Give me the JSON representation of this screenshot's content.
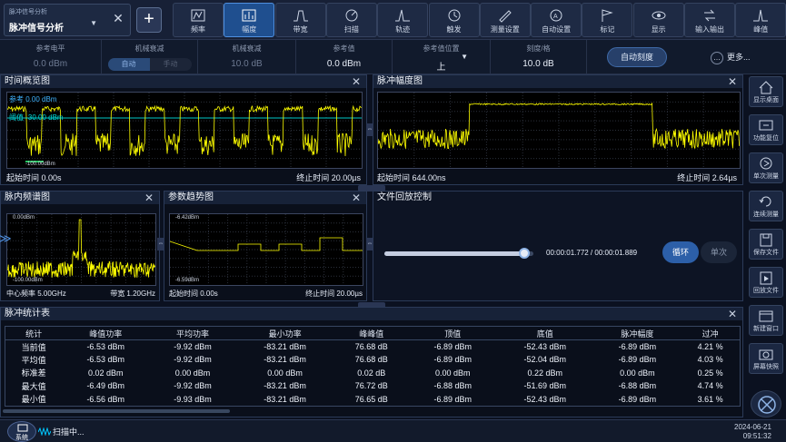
{
  "app": {
    "small_title": "脉冲信号分析",
    "title": "脉冲信号分析"
  },
  "toolbar": [
    {
      "key": "freq",
      "label": "频率",
      "icon": "frequency-icon"
    },
    {
      "key": "amp",
      "label": "幅度",
      "icon": "amplitude-icon",
      "selected": true
    },
    {
      "key": "bw",
      "label": "带宽",
      "icon": "bandwidth-icon"
    },
    {
      "key": "sweep",
      "label": "扫描",
      "icon": "sweep-icon"
    },
    {
      "key": "trace",
      "label": "轨迹",
      "icon": "trace-icon"
    },
    {
      "key": "trig",
      "label": "触发",
      "icon": "trigger-icon"
    },
    {
      "key": "meas",
      "label": "测量设置",
      "icon": "measure-settings-icon"
    },
    {
      "key": "auto",
      "label": "自动设置",
      "icon": "auto-settings-icon"
    },
    {
      "key": "marker",
      "label": "标记",
      "icon": "marker-icon"
    },
    {
      "key": "display",
      "label": "显示",
      "icon": "display-icon"
    },
    {
      "key": "io",
      "label": "输入输出",
      "icon": "input-output-icon"
    },
    {
      "key": "peak",
      "label": "峰值",
      "icon": "peak-icon"
    }
  ],
  "params": {
    "ref_level_label": "参考电平",
    "ref_level_value": "0.0 dBm",
    "mech_atten_label": "机械衰减",
    "mech_auto": "自动",
    "mech_manual": "手动",
    "mech_atten2_label": "机械衰减",
    "mech_atten2_value": "10.0 dB",
    "ref_value_label": "参考值",
    "ref_value_value": "0.0 dBm",
    "ref_pos_label": "参考值位置",
    "ref_pos_value": "上",
    "scale_label": "刻度/格",
    "scale_value": "10.0 dB",
    "auto_scale": "自动刻度",
    "more": "更多..."
  },
  "time_overview": {
    "title": "时间概览图",
    "ref_label": "参考 0.00 dBm",
    "threshold_label": "阈值 -30.00 dBm",
    "bottom_label": "-100.00dBm",
    "start": "起始时间 0.00s",
    "stop": "终止时间 20.00µs"
  },
  "pulse_amp": {
    "title": "脉冲幅度图",
    "start": "起始时间 644.00ns",
    "stop": "终止时间 2.64µs"
  },
  "intra_spectrum": {
    "title": "脉内频谱图",
    "top_label": "0.00dBm",
    "bottom_label": "-100.00dBm",
    "center": "中心频率 5.00GHz",
    "span": "带宽 1.20GHz"
  },
  "trend": {
    "title": "参数趋势图",
    "top_label": "-6.42dBm",
    "bottom_label": "-6.59dBm",
    "start": "起始时间 0.00s",
    "stop": "终止时间 20.00µs"
  },
  "playback": {
    "title": "文件回放控制",
    "progress": 0.94,
    "time": "00:00:01.772 / 00:00:01.889",
    "loop": "循环",
    "single": "单次"
  },
  "stats": {
    "title": "脉冲统计表",
    "headers": [
      "统计",
      "峰值功率",
      "平均功率",
      "最小功率",
      "峰峰值",
      "顶值",
      "底值",
      "脉冲幅度",
      "过冲"
    ],
    "rows": [
      [
        "当前值",
        "-6.53 dBm",
        "-9.92 dBm",
        "-83.21 dBm",
        "76.68 dB",
        "-6.89 dBm",
        "-52.43 dBm",
        "-6.89 dBm",
        "4.21 %"
      ],
      [
        "平均值",
        "-6.53 dBm",
        "-9.92 dBm",
        "-83.21 dBm",
        "76.68 dB",
        "-6.89 dBm",
        "-52.04 dBm",
        "-6.89 dBm",
        "4.03 %"
      ],
      [
        "标准差",
        "0.02 dBm",
        "0.00 dBm",
        "0.00 dBm",
        "0.02 dB",
        "0.00 dBm",
        "0.22 dBm",
        "0.00 dBm",
        "0.25 %"
      ],
      [
        "最大值",
        "-6.49 dBm",
        "-9.92 dBm",
        "-83.21 dBm",
        "76.72 dB",
        "-6.88 dBm",
        "-51.69 dBm",
        "-6.88 dBm",
        "4.74 %"
      ],
      [
        "最小值",
        "-6.56 dBm",
        "-9.93 dBm",
        "-83.21 dBm",
        "76.65 dB",
        "-6.89 dBm",
        "-52.43 dBm",
        "-6.89 dBm",
        "3.61 %"
      ]
    ]
  },
  "sidebar": [
    {
      "label": "显示桌面",
      "icon": "home-icon"
    },
    {
      "label": "功能复位",
      "icon": "reset-icon"
    },
    {
      "label": "单次测量",
      "icon": "single-measure-icon"
    },
    {
      "label": "连续测量",
      "icon": "continuous-measure-icon"
    },
    {
      "label": "保存文件",
      "icon": "save-icon"
    },
    {
      "label": "回放文件",
      "icon": "playback-file-icon"
    },
    {
      "label": "新建窗口",
      "icon": "new-window-icon"
    },
    {
      "label": "屏幕快照",
      "icon": "screenshot-icon"
    }
  ],
  "status": {
    "system": "系统",
    "scan": "扫描中...",
    "date": "2024-06-21",
    "time": "09:51:32"
  },
  "colors": {
    "trace": "#ffff00",
    "threshold": "#00c8c8",
    "accent": "#1f4f8f"
  }
}
